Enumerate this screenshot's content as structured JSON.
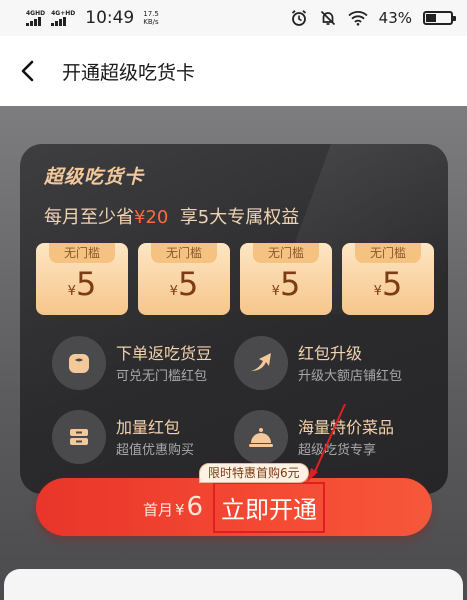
{
  "status_bar": {
    "sim1": "4GHD",
    "sim2": "4G+HD",
    "time": "10:49",
    "speed_value": "17.5",
    "speed_unit": "KB/s",
    "battery": "43%",
    "battery_level": 0.43
  },
  "header": {
    "title": "开通超级吃货卡"
  },
  "card": {
    "title": "超级吃货卡",
    "subtitle_prefix": "每月至少省",
    "subtitle_amount": "¥20",
    "subtitle_suffix": "享5大专属权益",
    "coupons": [
      {
        "tag": "无门槛",
        "currency": "¥",
        "value": "5"
      },
      {
        "tag": "无门槛",
        "currency": "¥",
        "value": "5"
      },
      {
        "tag": "无门槛",
        "currency": "¥",
        "value": "5"
      },
      {
        "tag": "无门槛",
        "currency": "¥",
        "value": "5"
      }
    ],
    "benefits": [
      {
        "title": "下单返吃货豆",
        "desc": "可兑无门槛红包",
        "icon": "bean-icon"
      },
      {
        "title": "红包升级",
        "desc": "升级大额店铺红包",
        "icon": "upgrade-arrow-icon"
      },
      {
        "title": "加量红包",
        "desc": "超值优惠购买",
        "icon": "coupon-stack-icon"
      },
      {
        "title": "海量特价菜品",
        "desc": "超级吃货专享",
        "icon": "cloche-icon"
      }
    ]
  },
  "cta": {
    "badge": "限时特惠首购6元",
    "prefix": "首月",
    "currency": "¥",
    "price": "6",
    "label": "立即开通"
  },
  "colors": {
    "accent_red": "#ef3c2d",
    "gold_text": "#f3c89a",
    "highlight": "#ff6a3d",
    "annotation": "#e02020"
  }
}
